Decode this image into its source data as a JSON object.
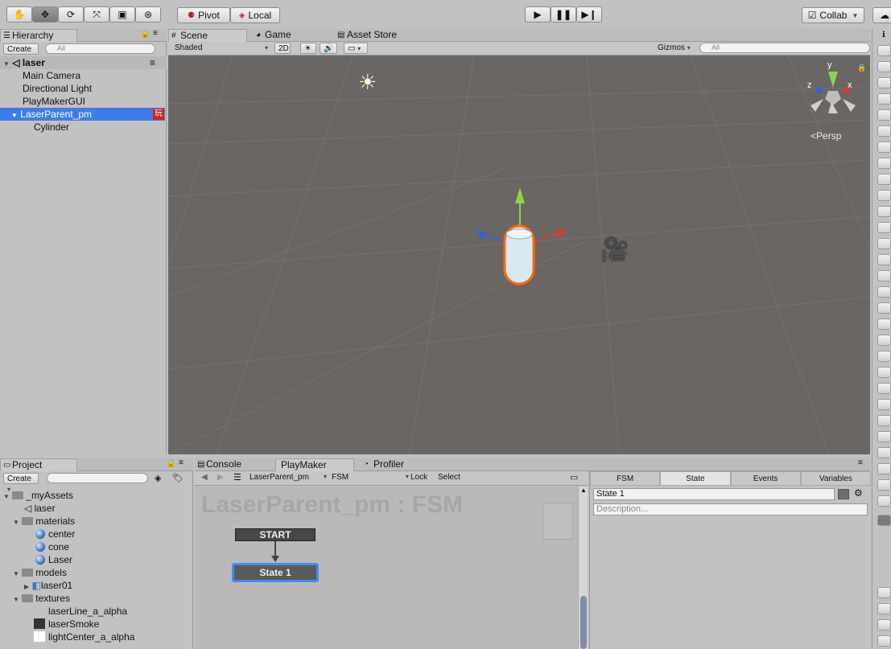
{
  "toolbar": {
    "pivot": "Pivot",
    "local": "Local",
    "collab": "Collab"
  },
  "hierarchy": {
    "tab": "Hierarchy",
    "create": "Create",
    "search_placeholder": "All",
    "scene": "laser",
    "items": [
      "Main Camera",
      "Directional Light",
      "PlayMakerGUI",
      "LaserParent_pm",
      "Cylinder"
    ],
    "badge": "玩"
  },
  "scene_tabs": {
    "scene": "Scene",
    "game": "Game",
    "asset_store": "Asset Store"
  },
  "scene_toolbar": {
    "shading": "Shaded",
    "mode2d": "2D",
    "gizmos": "Gizmos",
    "search_placeholder": "All"
  },
  "viewport": {
    "persp": "Persp",
    "axis_x": "x",
    "axis_y": "y",
    "axis_z": "z"
  },
  "project": {
    "tab": "Project",
    "create": "Create",
    "items": [
      "_myAssets",
      "laser",
      "materials",
      "center",
      "cone",
      "Laser",
      "models",
      "laser01",
      "textures",
      "laserLine_a_alpha",
      "laserSmoke",
      "lightCenter_a_alpha"
    ]
  },
  "bottom_tabs": {
    "console": "Console",
    "playmaker": "PlayMaker",
    "profiler": "Profiler"
  },
  "playmaker": {
    "object": "LaserParent_pm",
    "fsm": "FSM",
    "lock": "Lock",
    "select": "Select",
    "title": "LaserParent_pm : FSM",
    "start": "START",
    "state": "State 1"
  },
  "inspector": {
    "tabs": [
      "FSM",
      "State",
      "Events",
      "Variables"
    ],
    "state_name": "State 1",
    "description_placeholder": "Description..."
  }
}
